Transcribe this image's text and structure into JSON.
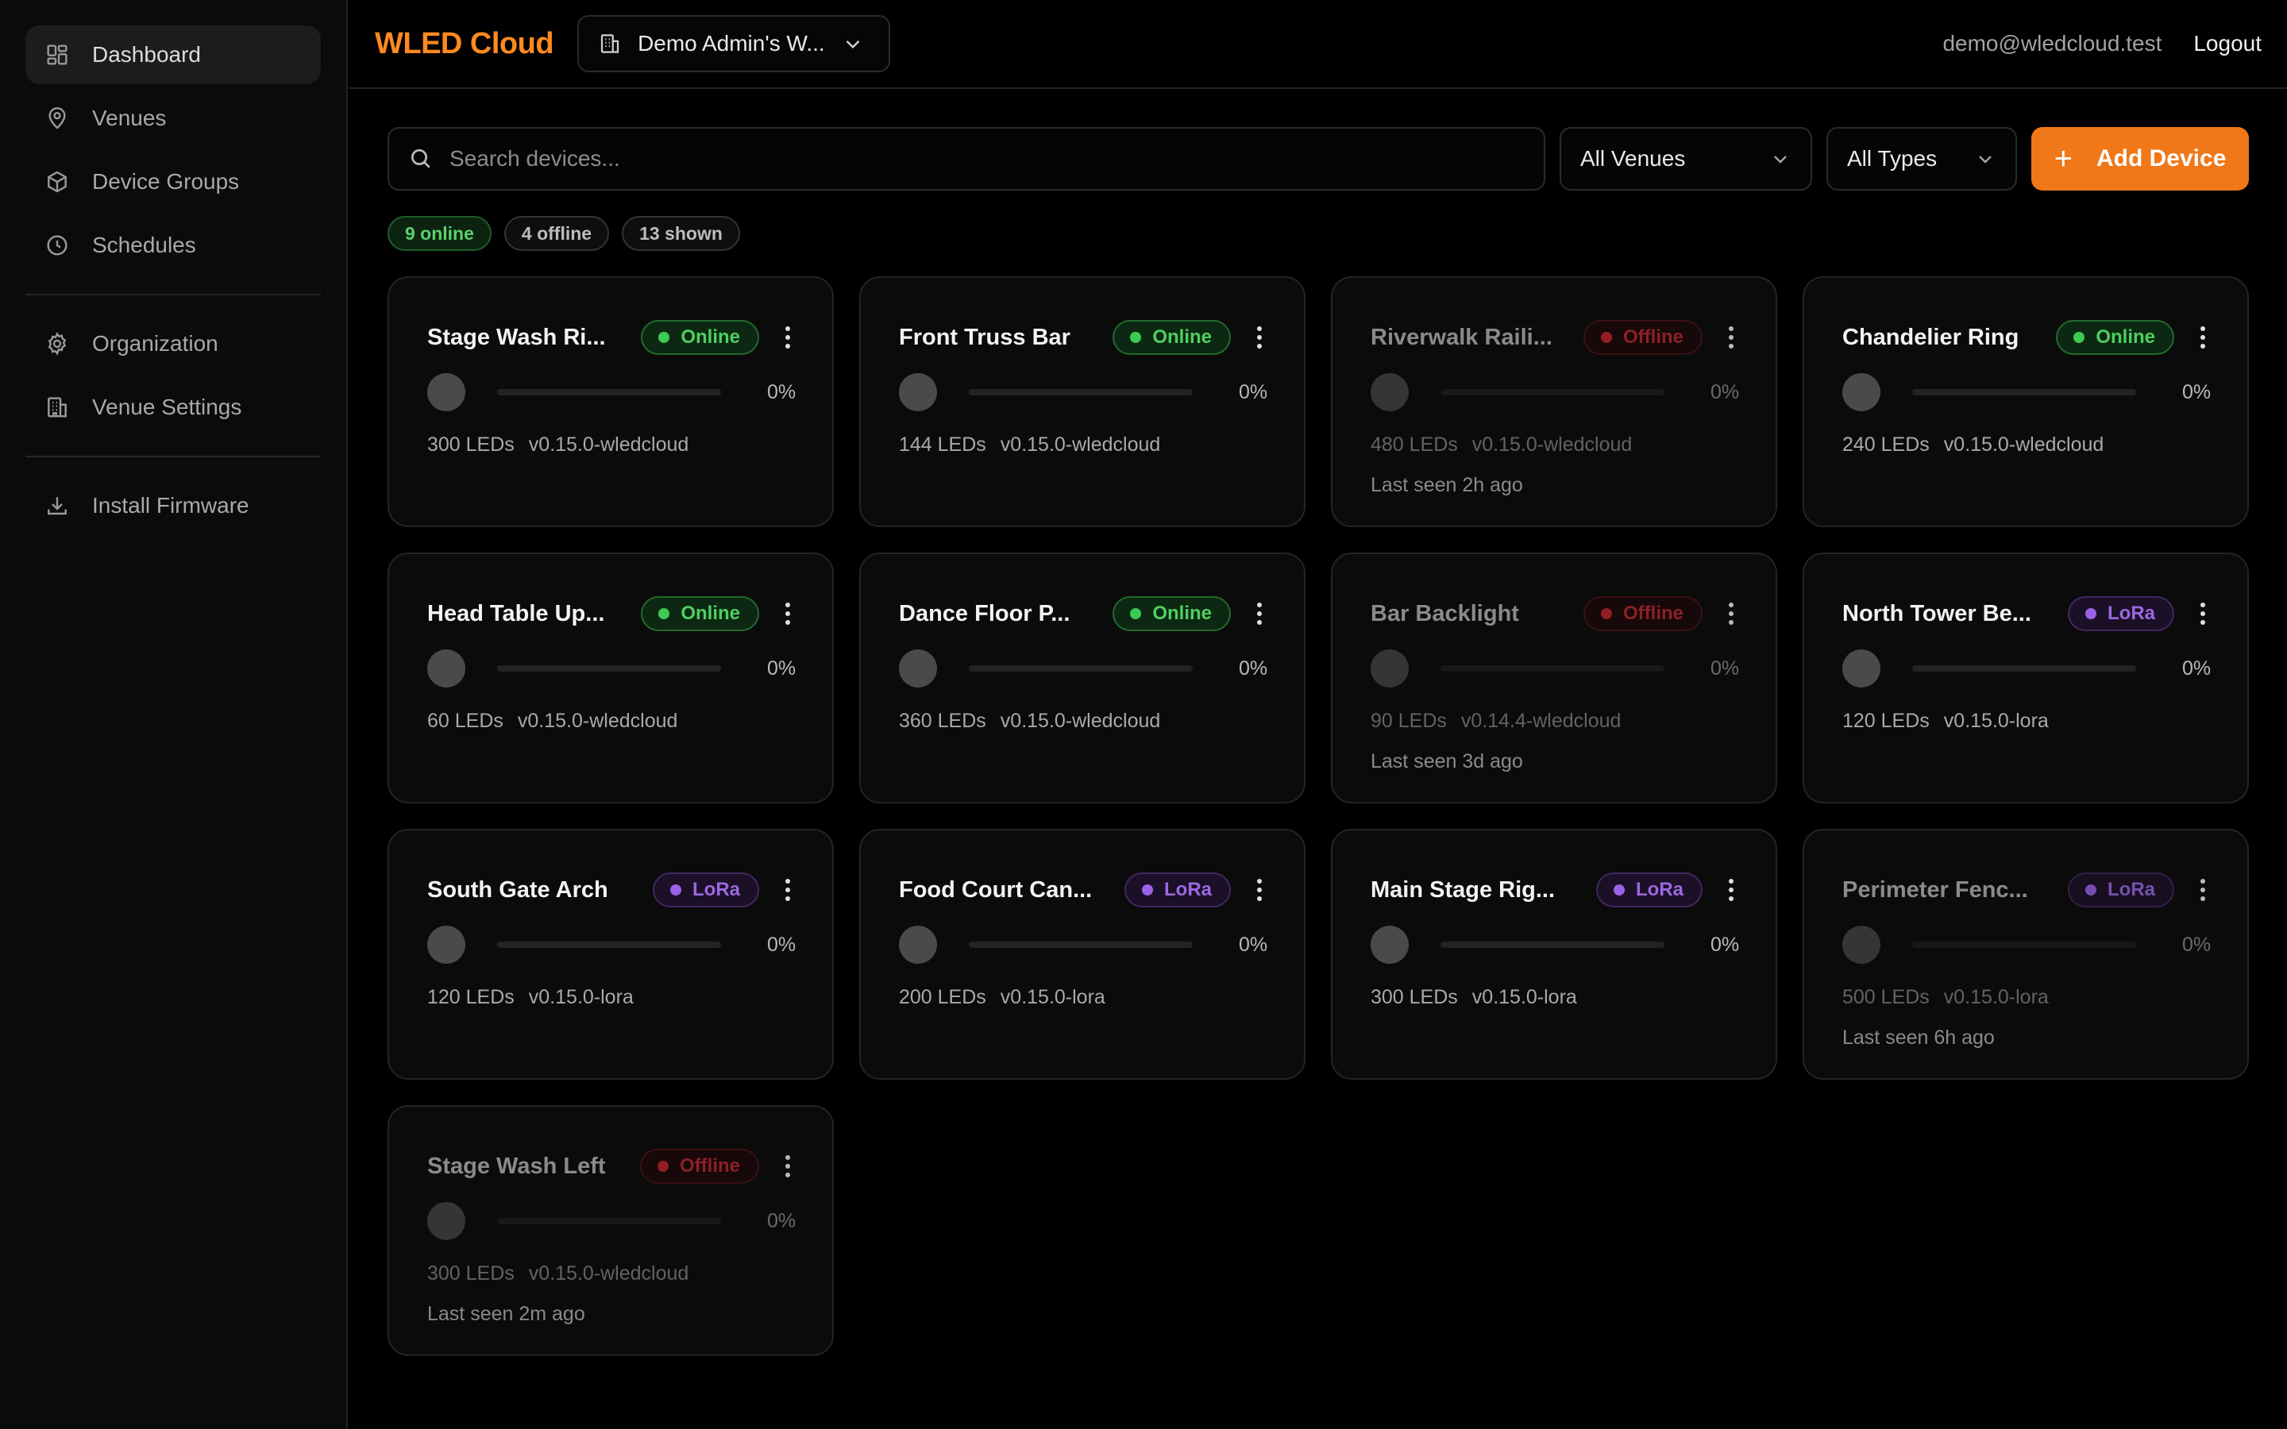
{
  "sidebar": {
    "items": [
      {
        "label": "Dashboard"
      },
      {
        "label": "Venues"
      },
      {
        "label": "Device Groups"
      },
      {
        "label": "Schedules"
      },
      {
        "label": "Organization"
      },
      {
        "label": "Venue Settings"
      },
      {
        "label": "Install Firmware"
      }
    ]
  },
  "header": {
    "brand": "WLED Cloud",
    "workspace": "Demo Admin's W...",
    "user_email": "demo@wledcloud.test",
    "logout_label": "Logout"
  },
  "toolbar": {
    "search_placeholder": "Search devices...",
    "venue_filter": "All Venues",
    "type_filter": "All Types",
    "add_label": "Add Device"
  },
  "stats": {
    "online": "9 online",
    "offline": "4 offline",
    "shown": "13 shown"
  },
  "colors": {
    "accent": "#f07818",
    "brand": "#ff8a1f",
    "online": "#3ccb52",
    "offline": "#c1242c",
    "lora": "#9a62e6"
  },
  "devices": [
    {
      "name": "Stage Wash Ri...",
      "status": "Online",
      "status_class": "online",
      "brightness": "0%",
      "leds": "300 LEDs",
      "version": "v0.15.0-wledcloud",
      "last_seen": ""
    },
    {
      "name": "Front Truss Bar",
      "status": "Online",
      "status_class": "online",
      "brightness": "0%",
      "leds": "144 LEDs",
      "version": "v0.15.0-wledcloud",
      "last_seen": ""
    },
    {
      "name": "Riverwalk Raili...",
      "status": "Offline",
      "status_class": "offline",
      "brightness": "0%",
      "leds": "480 LEDs",
      "version": "v0.15.0-wledcloud",
      "last_seen": "Last seen 2h ago"
    },
    {
      "name": "Chandelier Ring",
      "status": "Online",
      "status_class": "online",
      "brightness": "0%",
      "leds": "240 LEDs",
      "version": "v0.15.0-wledcloud",
      "last_seen": ""
    },
    {
      "name": "Head Table Up...",
      "status": "Online",
      "status_class": "online",
      "brightness": "0%",
      "leds": "60 LEDs",
      "version": "v0.15.0-wledcloud",
      "last_seen": ""
    },
    {
      "name": "Dance Floor P...",
      "status": "Online",
      "status_class": "online",
      "brightness": "0%",
      "leds": "360 LEDs",
      "version": "v0.15.0-wledcloud",
      "last_seen": ""
    },
    {
      "name": "Bar Backlight",
      "status": "Offline",
      "status_class": "offline",
      "brightness": "0%",
      "leds": "90 LEDs",
      "version": "v0.14.4-wledcloud",
      "last_seen": "Last seen 3d ago"
    },
    {
      "name": "North Tower Be...",
      "status": "LoRa",
      "status_class": "lora",
      "brightness": "0%",
      "leds": "120 LEDs",
      "version": "v0.15.0-lora",
      "last_seen": ""
    },
    {
      "name": "South Gate Arch",
      "status": "LoRa",
      "status_class": "lora",
      "brightness": "0%",
      "leds": "120 LEDs",
      "version": "v0.15.0-lora",
      "last_seen": ""
    },
    {
      "name": "Food Court Can...",
      "status": "LoRa",
      "status_class": "lora",
      "brightness": "0%",
      "leds": "200 LEDs",
      "version": "v0.15.0-lora",
      "last_seen": ""
    },
    {
      "name": "Main Stage Rig...",
      "status": "LoRa",
      "status_class": "lora",
      "brightness": "0%",
      "leds": "300 LEDs",
      "version": "v0.15.0-lora",
      "last_seen": ""
    },
    {
      "name": "Perimeter Fenc...",
      "status": "LoRa",
      "status_class": "lora",
      "brightness": "0%",
      "leds": "500 LEDs",
      "version": "v0.15.0-lora",
      "last_seen": "Last seen 6h ago"
    },
    {
      "name": "Stage Wash Left",
      "status": "Offline",
      "status_class": "offline",
      "brightness": "0%",
      "leds": "300 LEDs",
      "version": "v0.15.0-wledcloud",
      "last_seen": "Last seen 2m ago"
    }
  ]
}
